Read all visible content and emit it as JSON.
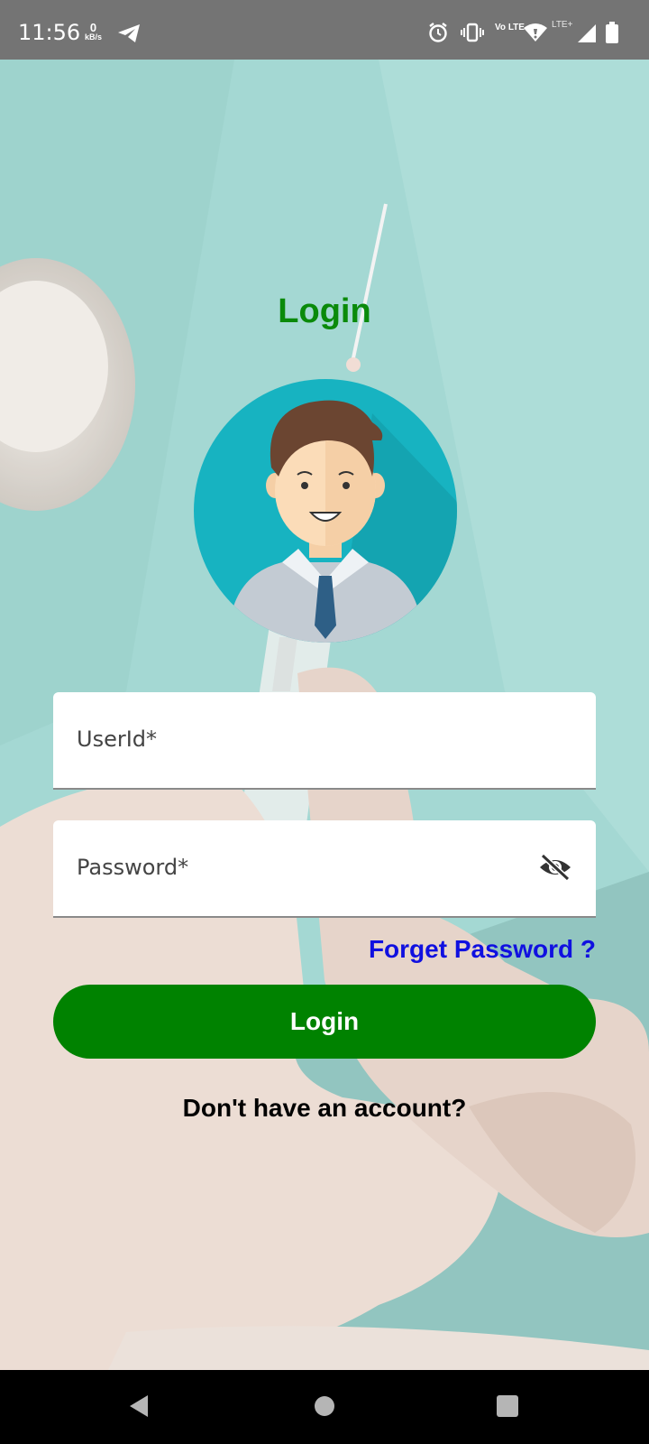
{
  "status_bar": {
    "time": "11:56",
    "net_speed_value": "0",
    "net_speed_unit": "kB/s",
    "icons": [
      "telegram-icon",
      "alarm-icon",
      "vibrate-icon",
      "volte-icon",
      "wifi-icon",
      "signal-icon",
      "battery-icon"
    ],
    "volte_label": "Vo LTE",
    "lte_label": "LTE+"
  },
  "login": {
    "title": "Login",
    "avatar": "user-avatar-illustration",
    "userid_label": "UserId*",
    "password_label": "Password*",
    "visibility_icon": "eye-off-icon",
    "forget_password": "Forget Password ?",
    "login_button": "Login",
    "no_account": "Don't have an account?"
  },
  "colors": {
    "title_green": "#0a8a0a",
    "button_green": "#008200",
    "link_blue": "#1010e0",
    "background_teal": "#9fd6d0"
  },
  "nav_bar": {
    "buttons": [
      "back-icon",
      "home-icon",
      "recents-icon"
    ]
  }
}
